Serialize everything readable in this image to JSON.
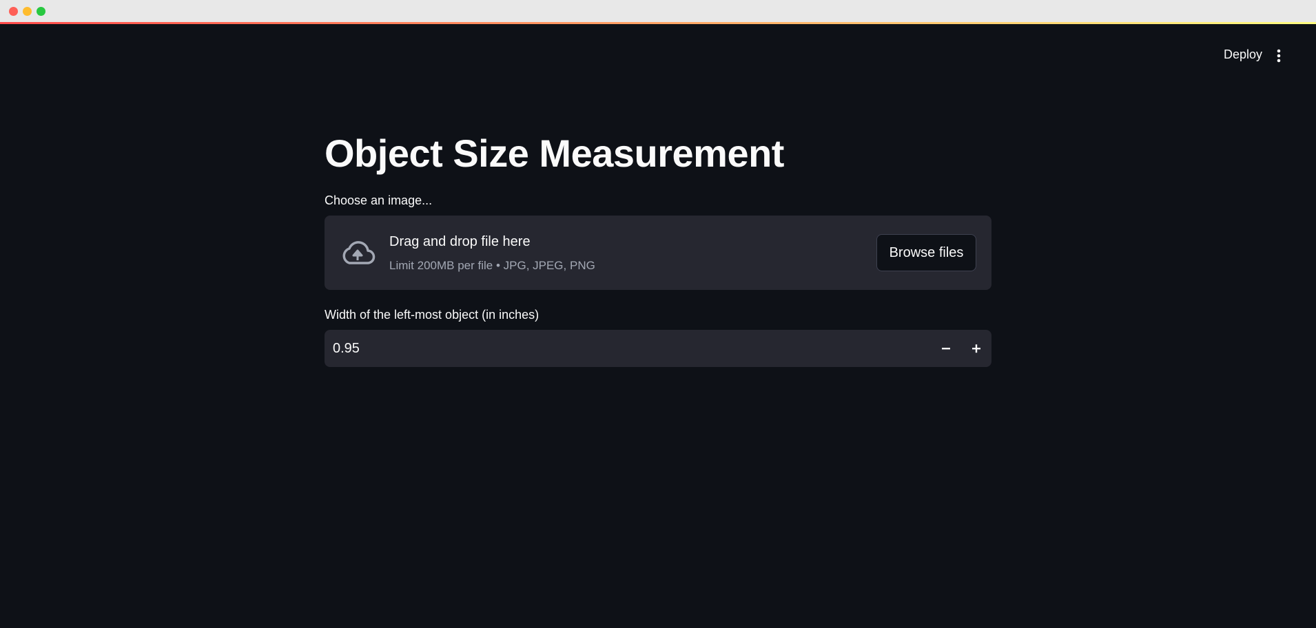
{
  "window": {
    "controls": [
      "close",
      "minimize",
      "maximize"
    ]
  },
  "header": {
    "deploy_label": "Deploy",
    "menu_icon": "vertical-ellipsis-icon"
  },
  "main": {
    "title": "Object Size Measurement",
    "uploader": {
      "label": "Choose an image...",
      "icon": "cloud-upload-icon",
      "drop_title": "Drag and drop file here",
      "drop_limit": "Limit 200MB per file • JPG, JPEG, PNG",
      "browse_label": "Browse files"
    },
    "width_input": {
      "label": "Width of the left-most object (in inches)",
      "value": "0.95",
      "decrement_icon": "minus-icon",
      "increment_icon": "plus-icon"
    }
  },
  "colors": {
    "background": "#0e1117",
    "surface": "#262730",
    "text": "#fafafa",
    "muted_text": "#a3a8b4",
    "accent_gradient_start": "#ff4b4b",
    "accent_gradient_end": "#fffd80"
  }
}
